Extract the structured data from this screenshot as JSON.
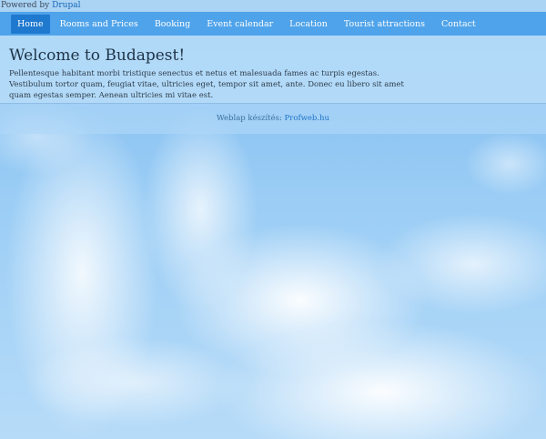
{
  "powered_by": {
    "prefix": "Powered by",
    "link": "Drupal"
  },
  "nav": {
    "items": [
      {
        "label": "Home",
        "active": true
      },
      {
        "label": "Rooms and Prices",
        "active": false
      },
      {
        "label": "Booking",
        "active": false
      },
      {
        "label": "Event calendar",
        "active": false
      },
      {
        "label": "Location",
        "active": false
      },
      {
        "label": "Tourist attractions",
        "active": false
      },
      {
        "label": "Contact",
        "active": false
      }
    ]
  },
  "main": {
    "title": "Welcome to Budapest!",
    "body": "Pellentesque habitant morbi tristique senectus et netus et malesuada fames ac turpis egestas. Vestibulum tortor quam, feugiat vitae, ultricies eget, tempor sit amet, ante. Donec eu libero sit amet quam egestas semper. Aenean ultricies mi vitae est."
  },
  "footer": {
    "prefix": "Weblap készítés:",
    "link": "Profweb.hu"
  },
  "colors": {
    "nav_bg": "#4fa3ea",
    "nav_active": "#1f79cf",
    "link": "#1466b8"
  }
}
